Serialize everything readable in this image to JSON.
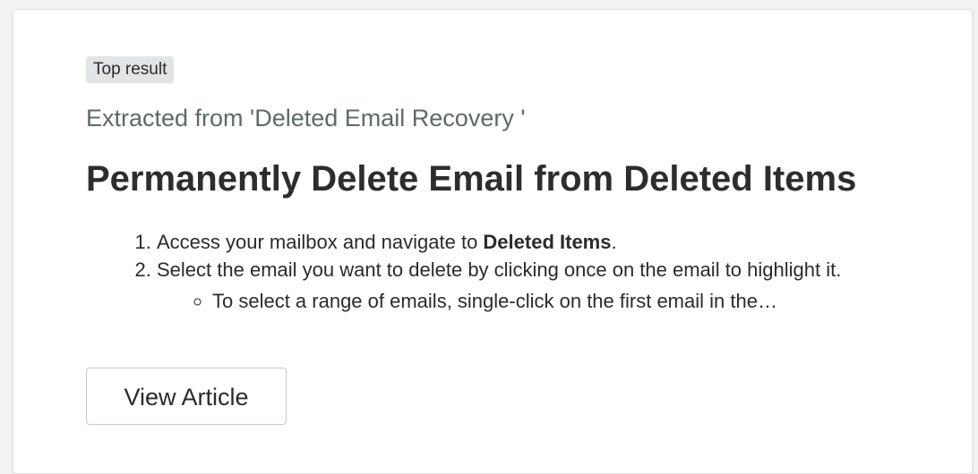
{
  "badge": "Top result",
  "source": "Extracted from 'Deleted Email Recovery '",
  "title": "Permanently Delete Email from Deleted Items",
  "steps": [
    {
      "text_before": "Access your mailbox and navigate to ",
      "bold": "Deleted Items",
      "text_after": "."
    },
    {
      "text": "Select the email you want to delete by clicking once on the email to highlight it."
    }
  ],
  "substeps": [
    "To select a range of emails, single-click on the first email in the…"
  ],
  "button_label": "View Article"
}
